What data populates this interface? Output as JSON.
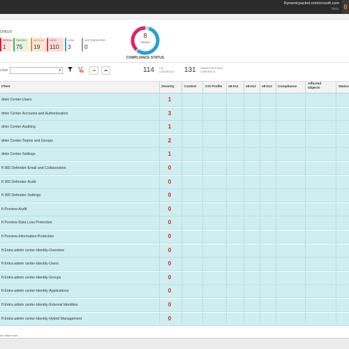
{
  "header": {
    "tenant": "Dynamicpacket.onmicrosoft.com",
    "tenant_sub": "TEDL",
    "badge": "0"
  },
  "findings": {
    "label": "DINGS",
    "cards": [
      {
        "label": "RITICAL",
        "value": "1"
      },
      {
        "label": "PASSED",
        "value": "75"
      },
      {
        "label": "MEDIUM",
        "value": "19"
      },
      {
        "label": "HIGH",
        "value": "110"
      },
      {
        "label": "LOW",
        "value": "3"
      },
      {
        "label": "NOT EXECUTED",
        "value": "0"
      }
    ]
  },
  "compliance": {
    "issues_count": "8",
    "issues_label": "Issues",
    "status_label": "COMPLIANCE STATUS",
    "ring_fraction": 0.38,
    "ring_colors": {
      "primary": "#e0245e",
      "secondary": "#2a9fd6",
      "track": "#b9d9ee"
    }
  },
  "filter": {
    "label": "LTER",
    "cis_count": "114",
    "cis_label_1": "CIS",
    "cis_label_2": "CONTROLS",
    "smart_count": "131",
    "smart_label_1": "SMARTPROFILER",
    "smart_label_2": "CONTROLS"
  },
  "table": {
    "columns": [
      "t/Test",
      "Severity",
      "Control",
      "CIS Profile",
      "v8-IG1",
      "v8-IG2",
      "v8-IG3",
      "Compliance",
      "Affected Objects",
      "Status"
    ],
    "rows": [
      {
        "title": "dmin Center-Users",
        "severity": "1"
      },
      {
        "title": "dmin Center-Accounts and Authentication",
        "severity": "3"
      },
      {
        "title": "dmin Center-Auditing",
        "severity": "1"
      },
      {
        "title": "dmin Center-Teams and Groups",
        "severity": "2"
      },
      {
        "title": "dmin Center-Settings",
        "severity": "1"
      },
      {
        "title": "ft 365 Defender-Email and Collaboration",
        "severity": "0"
      },
      {
        "title": "ft 365 Defender-Audit",
        "severity": "0"
      },
      {
        "title": "ft 365 Defender-Settings",
        "severity": "0"
      },
      {
        "title": "ft Purview-Audit",
        "severity": "0"
      },
      {
        "title": "ft Purview-Data Loss Protection",
        "severity": "0"
      },
      {
        "title": "ft Purview-Information Protection",
        "severity": "0"
      },
      {
        "title": "ft Entra admin center-Identity-Overview",
        "severity": "0"
      },
      {
        "title": "ft Entra admin center-Identity-Users",
        "severity": "0"
      },
      {
        "title": "ft Entra admin center-Identity-Groups",
        "severity": "0"
      },
      {
        "title": "ft Entra admin center-Identity-Applications",
        "severity": "0"
      },
      {
        "title": "ft Entra admin center-Identity-External Identities",
        "severity": "0"
      },
      {
        "title": "ft Entra admin center-Identity-Hybrid Management",
        "severity": "0"
      }
    ]
  },
  "footer": {
    "text": "ult Value none"
  },
  "icons": {
    "filter": "filter-icon",
    "clear_filter": "clear-filter-icon",
    "export_orange": "export-icon",
    "export_green": "download-icon"
  }
}
